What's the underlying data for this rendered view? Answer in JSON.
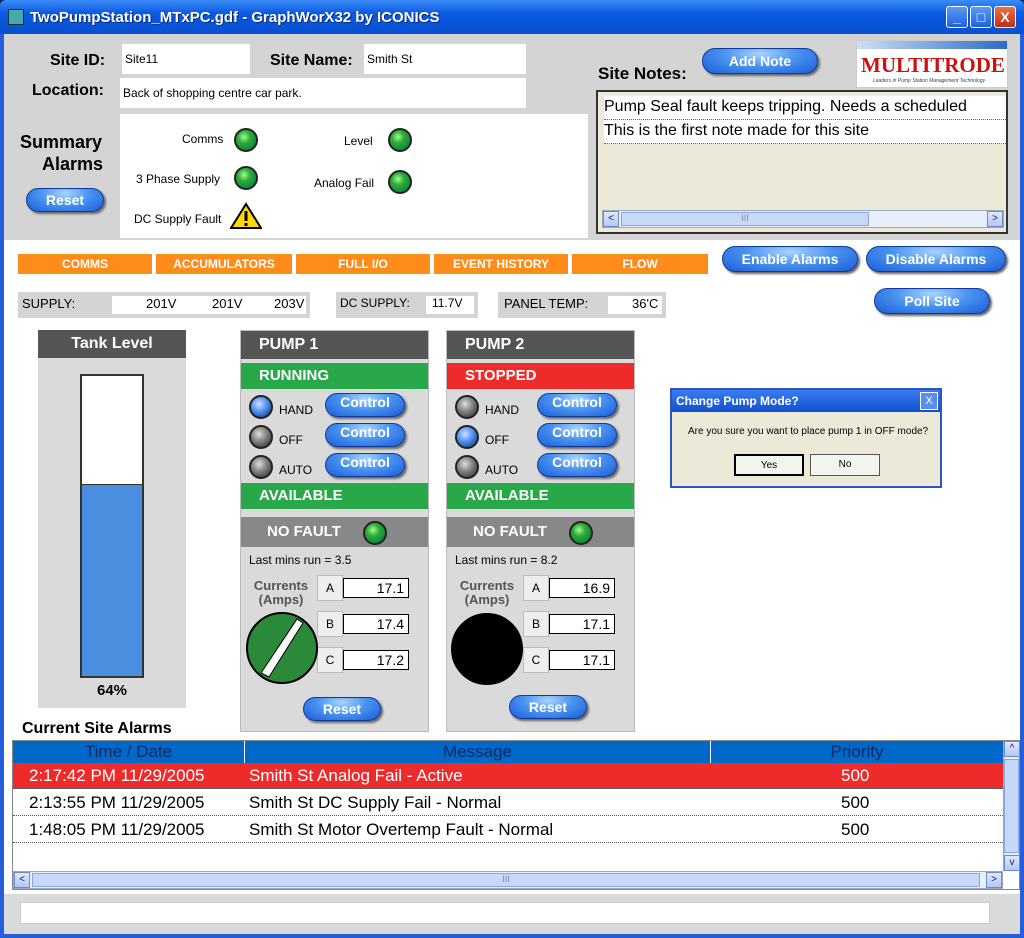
{
  "window": {
    "title": "TwoPumpStation_MTxPC.gdf - GraphWorX32 by ICONICS",
    "minimize": "_",
    "maximize": "□",
    "close": "X"
  },
  "site": {
    "id_label": "Site ID:",
    "id_value": "Site11",
    "name_label": "Site Name:",
    "name_value": "Smith St",
    "location_label": "Location:",
    "location_value": "Back of shopping centre car park."
  },
  "summary": {
    "title_line1": "Summary",
    "title_line2": "Alarms",
    "reset": "Reset",
    "alarms": {
      "comms": "Comms",
      "level": "Level",
      "three_phase": "3 Phase Supply",
      "analog_fail": "Analog Fail",
      "dc_supply_fault": "DC Supply Fault"
    }
  },
  "notes": {
    "label": "Site Notes:",
    "add_note": "Add Note",
    "items": [
      "Pump Seal fault keeps tripping. Needs a scheduled",
      "This is the first note made for this site"
    ],
    "scroll_thumb": "III",
    "scroll_left": "<",
    "scroll_right": ">"
  },
  "logo": {
    "name": "MULTITRODE",
    "tagline": "Leaders in Pump Station Management Technology"
  },
  "tabs": [
    "COMMS",
    "ACCUMULATORS",
    "FULL I/O",
    "EVENT HISTORY",
    "FLOW"
  ],
  "actions": {
    "enable_alarms": "Enable Alarms",
    "disable_alarms": "Disable Alarms",
    "poll_site": "Poll Site"
  },
  "supply": {
    "label": "SUPPLY:",
    "v1": "201V",
    "v2": "201V",
    "v3": "203V",
    "dc_label": "DC SUPPLY:",
    "dc_value": "11.7V",
    "temp_label": "PANEL TEMP:",
    "temp_value": "36'C"
  },
  "tank": {
    "title": "Tank Level",
    "level_text": "64%",
    "level_fraction": 0.64
  },
  "pumps": [
    {
      "title": "PUMP 1",
      "state": "RUNNING",
      "state_color": "#29a84a",
      "modes": {
        "hand": "HAND",
        "off": "OFF",
        "auto": "AUTO"
      },
      "active_mode": "hand",
      "control": "Control",
      "availability": "AVAILABLE",
      "fault": "NO FAULT",
      "last_run": "Last mins run = 3.5",
      "currents_label_1": "Currents",
      "currents_label_2": "(Amps)",
      "phases": [
        {
          "name": "A",
          "value": "17.1"
        },
        {
          "name": "B",
          "value": "17.4"
        },
        {
          "name": "C",
          "value": "17.2"
        }
      ],
      "reset": "Reset"
    },
    {
      "title": "PUMP 2",
      "state": "STOPPED",
      "state_color": "#ee2b2b",
      "modes": {
        "hand": "HAND",
        "off": "OFF",
        "auto": "AUTO"
      },
      "active_mode": "off",
      "control": "Control",
      "availability": "AVAILABLE",
      "fault": "NO FAULT",
      "last_run": "Last mins run = 8.2",
      "currents_label_1": "Currents",
      "currents_label_2": "(Amps)",
      "phases": [
        {
          "name": "A",
          "value": "16.9"
        },
        {
          "name": "B",
          "value": "17.1"
        },
        {
          "name": "C",
          "value": "17.1"
        }
      ],
      "reset": "Reset"
    }
  ],
  "dialog": {
    "title": "Change Pump Mode?",
    "message": "Are you sure you want to place pump 1 in OFF mode?",
    "yes": "Yes",
    "no": "No",
    "close": "X"
  },
  "alarms": {
    "title": "Current Site Alarms",
    "columns": [
      "Time / Date",
      "Message",
      "Priority"
    ],
    "rows": [
      {
        "time": "2:17:42 PM  11/29/2005",
        "message": "Smith St Analog Fail - Active",
        "priority": "500",
        "highlight": true
      },
      {
        "time": "2:13:55 PM  11/29/2005",
        "message": "Smith St DC Supply Fail - Normal",
        "priority": "500",
        "highlight": false
      },
      {
        "time": "1:48:05 PM  11/29/2005",
        "message": "Smith St  Motor Overtemp Fault - Normal",
        "priority": "500",
        "highlight": false
      }
    ],
    "scroll_up": "^",
    "scroll_down": "v",
    "scroll_left": "<",
    "scroll_right": ">",
    "scroll_thumb": "III"
  },
  "colors": {
    "running": "#29a84a",
    "stopped": "#ee2b2b",
    "tab_orange": "#ff8c1a",
    "header_blue": "#0068c8",
    "tank_fill": "#4a8ee0"
  }
}
